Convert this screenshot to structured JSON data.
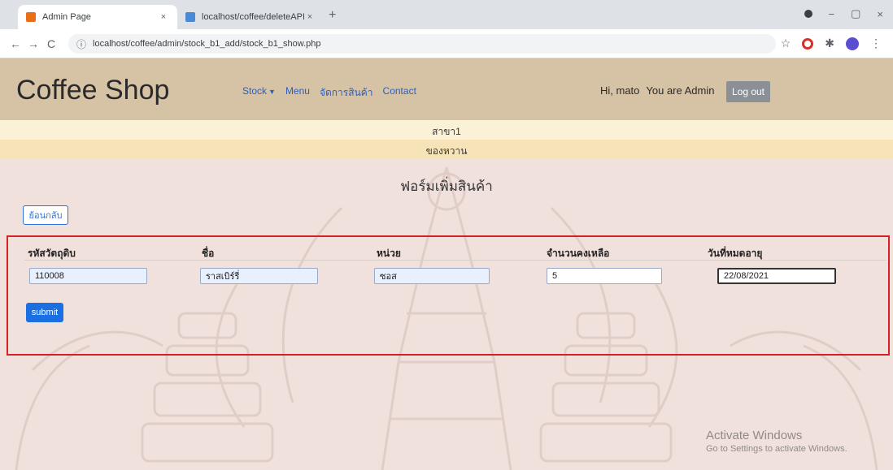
{
  "browser": {
    "tabs": [
      {
        "title": "Admin Page",
        "active": true,
        "favicon": "admin-page-favicon"
      },
      {
        "title": "localhost/coffee/deleteAPI.php?",
        "active": false,
        "favicon": "localhost-favicon"
      }
    ],
    "new_tab_glyph": "+",
    "close_glyph": "×",
    "url": "localhost/coffee/admin/stock_b1_add/stock_b1_show.php",
    "nav": {
      "back": "←",
      "forward": "→",
      "reload": "C",
      "info": "ⓘ"
    },
    "window_controls": {
      "minimize": "−",
      "maximize": "▢",
      "close": "×"
    },
    "toolbar_icons": {
      "star": "☆",
      "puzzle": "✱",
      "menu": "⋮"
    }
  },
  "site": {
    "brand": "Coffee Shop",
    "menu": [
      {
        "label": "Stock",
        "has_dropdown": true
      },
      {
        "label": "Menu"
      },
      {
        "label": "จัดการสินค้า"
      },
      {
        "label": "Contact"
      }
    ],
    "user_greeting": "Hi, mato",
    "user_role": "You are Admin",
    "logout_label": "Log out"
  },
  "bands": {
    "line1": "สาขา1",
    "line2": "ของหวาน"
  },
  "page": {
    "title": "ฟอร์มเพิ่มสินค้า",
    "back_label": "ย้อนกลับ"
  },
  "form": {
    "fields": [
      {
        "label": "รหัสวัตถุดิบ",
        "value": "110008"
      },
      {
        "label": "ชื่อ",
        "value": "ราสเบิร์รี่"
      },
      {
        "label": "หน่วย",
        "value": "ซอส"
      },
      {
        "label": "จำนวนคงเหลือ",
        "value": "5"
      },
      {
        "label": "วันที่หมดอายุ",
        "value": "22/08/2021"
      }
    ],
    "submit_label": "submit"
  },
  "overlay": {
    "line1": "Activate Windows",
    "line2": "Go to Settings to activate Windows."
  },
  "colors": {
    "header": "#d6c2a4",
    "page_bg": "#f1e1dd",
    "highlight_frame": "#d02323",
    "primary_button": "#1b6fe3"
  }
}
